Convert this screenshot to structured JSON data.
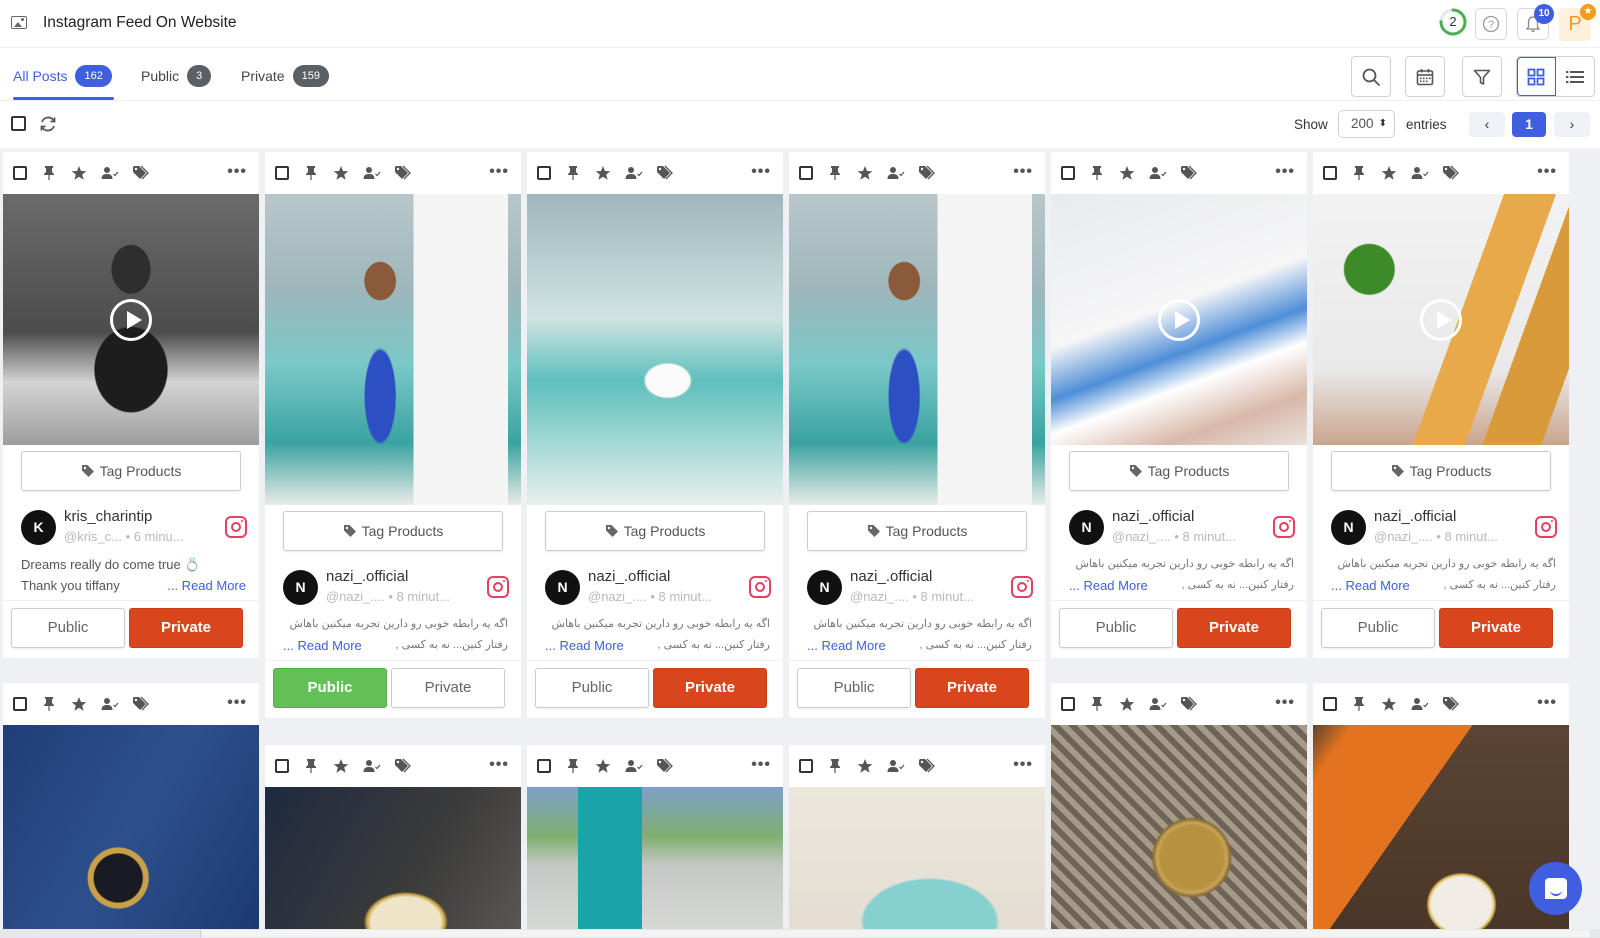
{
  "header": {
    "title": "Instagram Feed On Website",
    "progress_value": "2",
    "progress_fraction": 0.75,
    "notification_count": "10",
    "avatar_initial": "P",
    "icons": {
      "app": "image-icon",
      "help": "question-circle-icon",
      "bell": "bell-icon",
      "star": "star-badge-icon"
    }
  },
  "tabs": [
    {
      "label": "All Posts",
      "count": "162",
      "active": true
    },
    {
      "label": "Public",
      "count": "3",
      "active": false
    },
    {
      "label": "Private",
      "count": "159",
      "active": false
    }
  ],
  "toolbar": {
    "icons": [
      "search-icon",
      "calendar-icon",
      "filter-icon",
      "grid-view-icon",
      "list-view-icon"
    ],
    "active_view": "grid"
  },
  "controls": {
    "show_label": "Show",
    "entries_value": "200",
    "entries_label": "entries",
    "current_page": "1",
    "prev": "‹",
    "next": "›"
  },
  "colors": {
    "accent": "#3f5fe0",
    "private_active": "#d9461e",
    "public_active": "#62c057",
    "instagram": "#e4405f"
  },
  "card_labels": {
    "tag_products": "Tag Products",
    "read_more": "... Read More",
    "public": "Public",
    "private": "Private",
    "more": "•••"
  },
  "posts": [
    {
      "author": "kris_charintip",
      "initial": "K",
      "handle": "@kris_c...",
      "time": "6 minu...",
      "caption_line1": "Dreams really do come true 💍",
      "caption_line2": "Thank you tiffany",
      "rtl": false,
      "status": "Private",
      "is_video": true,
      "image": "bw-dinner"
    },
    {
      "author": "nazi_.official",
      "initial": "N",
      "handle": "@nazi_....",
      "time": "8 minut...",
      "caption_line1": "اگه یه رابطه خوبی رو دارین تجربه میکنین باهاش",
      "caption_line2": "رفتار کنین... نه به کسی ,",
      "rtl": true,
      "status": "Public",
      "is_video": false,
      "image": "tiffany-cafe-1"
    },
    {
      "author": "nazi_.official",
      "initial": "N",
      "handle": "@nazi_....",
      "time": "8 minut...",
      "caption_line1": "اگه یه رابطه خوبی رو دارین تجربه میکنین باهاش",
      "caption_line2": "رفتار کنین... نه به کسی ,",
      "rtl": true,
      "status": "Private",
      "is_video": false,
      "image": "tiffany-cafe-2"
    },
    {
      "author": "nazi_.official",
      "initial": "N",
      "handle": "@nazi_....",
      "time": "8 minut...",
      "caption_line1": "اگه یه رابطه خوبی رو دارین تجربه میکنین باهاش",
      "caption_line2": "رفتار کنین... نه به کسی ,",
      "rtl": true,
      "status": "Private",
      "is_video": false,
      "image": "tiffany-cafe-3"
    },
    {
      "author": "nazi_.official",
      "initial": "N",
      "handle": "@nazi_....",
      "time": "8 minut...",
      "caption_line1": "اگه یه رابطه خوبی رو دارین تجربه میکنین باهاش",
      "caption_line2": "رفتار کنین... نه به کسی ,",
      "rtl": true,
      "status": "Private",
      "is_video": true,
      "image": "hand-plate"
    },
    {
      "author": "nazi_.official",
      "initial": "N",
      "handle": "@nazi_....",
      "time": "8 minut...",
      "caption_line1": "اگه یه رابطه خوبی رو دارین تجربه میکنین باهاش",
      "caption_line2": "رفتار کنین... نه به کسی ,",
      "rtl": true,
      "status": "Private",
      "is_video": true,
      "image": "salad-pastry"
    }
  ],
  "second_row_images": [
    "gold-rolex-denim",
    "cartier-watch-leather",
    "tiffany-bag-city",
    "tiffany-wallet",
    "gold-watch-texture",
    "orange-strap-watch"
  ]
}
